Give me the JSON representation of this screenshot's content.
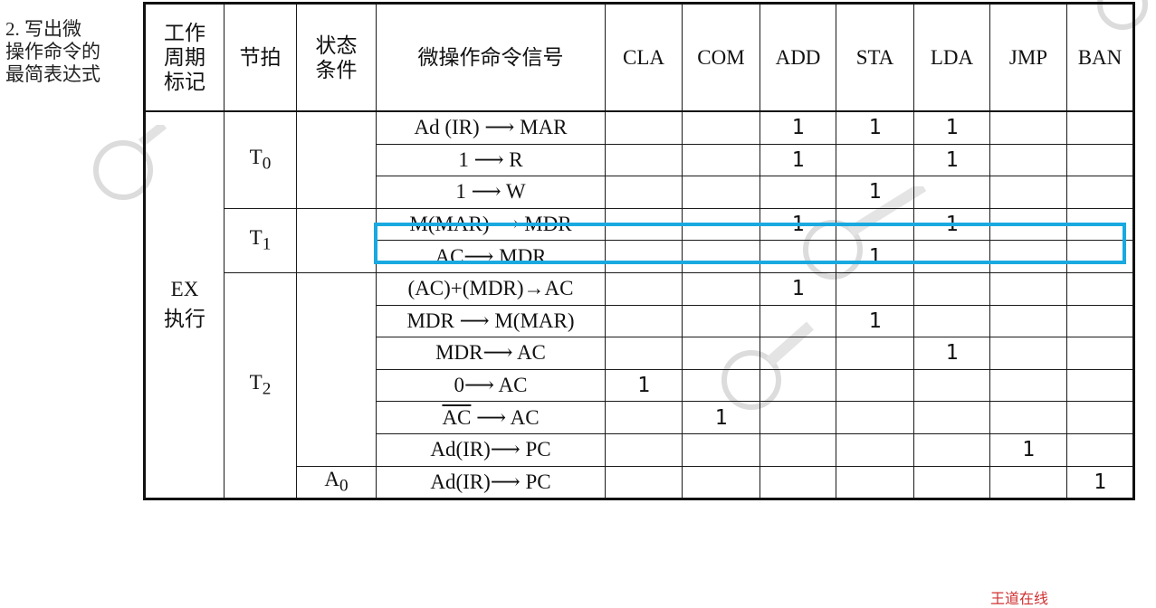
{
  "caption": [
    "2. 写出微",
    "操作命令的",
    "最简表达式"
  ],
  "header": {
    "cycle": [
      "工作",
      "周期",
      "标记"
    ],
    "beat": "节拍",
    "condition": [
      "状态",
      "条件"
    ],
    "signal": "微操作命令信号",
    "instructions": [
      "CLA",
      "COM",
      "ADD",
      "STA",
      "LDA",
      "JMP",
      "BAN"
    ]
  },
  "cycle_label": [
    "EX",
    "执行"
  ],
  "beats": {
    "t0": "T",
    "t0_sub": "0",
    "t1": "T",
    "t1_sub": "1",
    "t2": "T",
    "t2_sub": "2"
  },
  "condition_a0": "A",
  "condition_a0_sub": "0",
  "rows": [
    {
      "signal": "Ad (IR) ⟶ MAR",
      "cells": [
        "",
        "",
        "1",
        "1",
        "1",
        "",
        ""
      ]
    },
    {
      "signal": "1 ⟶ R",
      "cells": [
        "",
        "",
        "1",
        "",
        "1",
        "",
        ""
      ]
    },
    {
      "signal": "1 ⟶ W",
      "cells": [
        "",
        "",
        "",
        "1",
        "",
        "",
        ""
      ]
    },
    {
      "signal": "M(MAR)⟶ MDR",
      "cells": [
        "",
        "",
        "1",
        "",
        "1",
        "",
        ""
      ]
    },
    {
      "signal": "AC⟶ MDR",
      "cells": [
        "",
        "",
        "",
        "1",
        "",
        "",
        ""
      ]
    },
    {
      "signal": "(AC)+(MDR)→AC",
      "cells": [
        "",
        "",
        "1",
        "",
        "",
        "",
        ""
      ]
    },
    {
      "signal": "MDR ⟶ M(MAR)",
      "cells": [
        "",
        "",
        "",
        "1",
        "",
        "",
        ""
      ]
    },
    {
      "signal": "MDR⟶ AC",
      "cells": [
        "",
        "",
        "",
        "",
        "1",
        "",
        ""
      ]
    },
    {
      "signal": "0⟶ AC",
      "cells": [
        "1",
        "",
        "",
        "",
        "",
        "",
        ""
      ]
    },
    {
      "signal_overline": "AC",
      "signal_rest": " ⟶ AC",
      "cells": [
        "",
        "1",
        "",
        "",
        "",
        "",
        ""
      ]
    },
    {
      "signal": "Ad(IR)⟶ PC",
      "cells": [
        "",
        "",
        "",
        "",
        "",
        "1",
        ""
      ]
    },
    {
      "signal": "Ad(IR)⟶ PC",
      "cells": [
        "",
        "",
        "",
        "",
        "",
        "",
        "1"
      ]
    }
  ],
  "footer_mark": "王道在线",
  "colors": {
    "highlight": "#19a9e0",
    "watermark": "#d8d8d8"
  }
}
